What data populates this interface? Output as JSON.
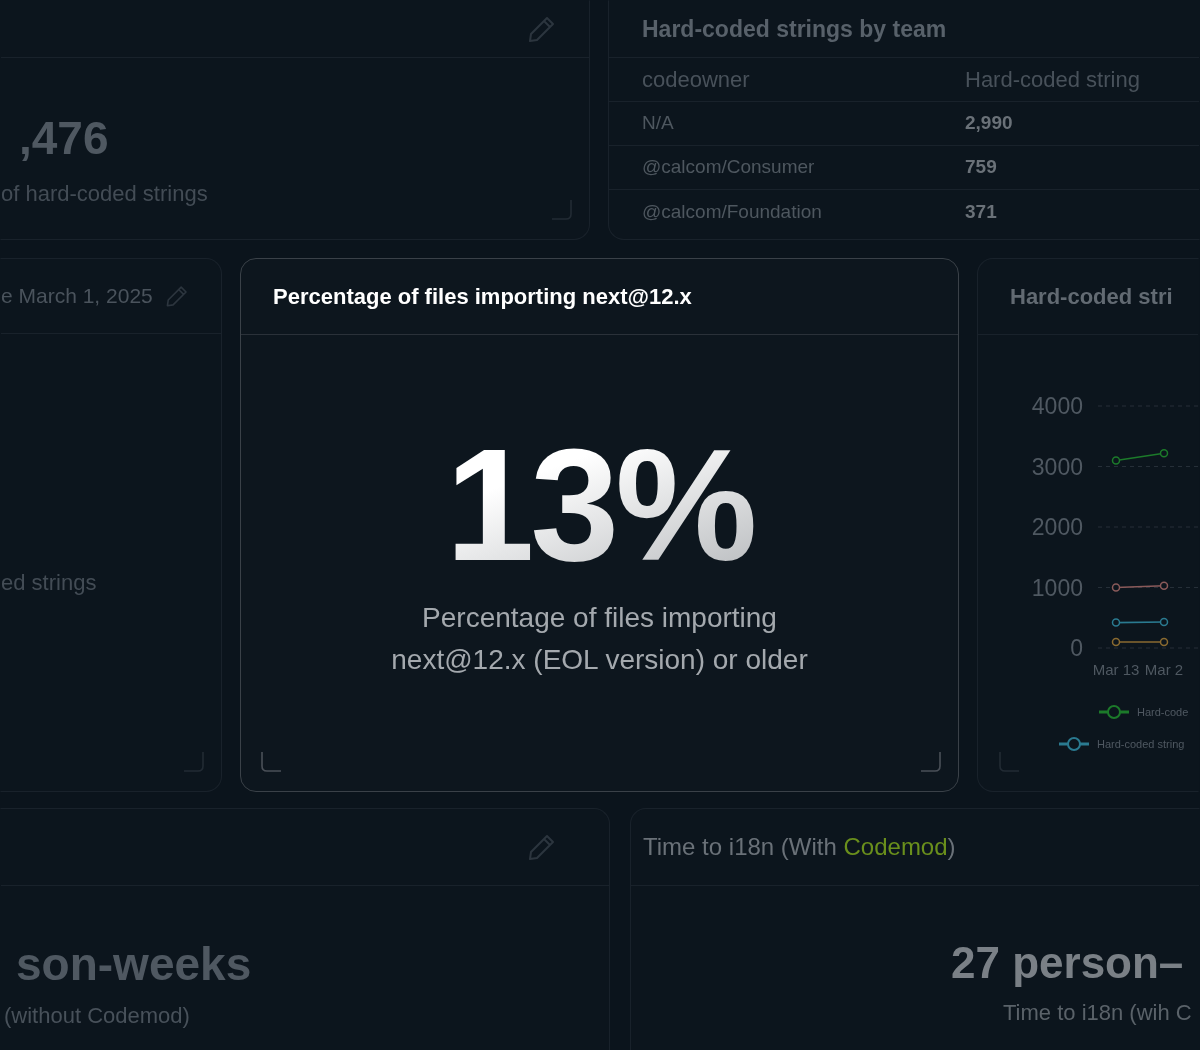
{
  "background_cards": [
    {
      "kind": "stat",
      "value": ",476",
      "caption": "of hard-coded strings"
    },
    {
      "kind": "table",
      "title": "Hard-coded strings by team",
      "columns": [
        "codeowner",
        "Hard-coded string"
      ],
      "rows": [
        [
          "N/A",
          "2,990"
        ],
        [
          "@calcom/Consumer",
          "759"
        ],
        [
          "@calcom/Foundation",
          "371"
        ]
      ]
    },
    {
      "kind": "stat",
      "title": "e March 1, 2025",
      "caption": "ed strings"
    },
    {
      "kind": "chart",
      "title": "Hard-coded stri",
      "chart_data": {
        "type": "line",
        "categories": [
          "Mar 13",
          "Mar 2"
        ],
        "ylim": [
          0,
          4000
        ],
        "yticks": [
          0,
          1000,
          2000,
          3000,
          4000
        ],
        "grid": true,
        "legend": true,
        "series": [
          {
            "name": "Hard-code",
            "color": "#1c7a2a",
            "marker": true,
            "values": [
              3100,
              3220
            ]
          },
          {
            "color": "#8a5a5a",
            "marker": true,
            "values": [
              1000,
              1030
            ]
          },
          {
            "name": "Hard-coded string",
            "color": "#2a7a90",
            "marker": true,
            "values": [
              420,
              430
            ]
          },
          {
            "color": "#8a6a30",
            "marker": true,
            "values": [
              100,
              100
            ]
          }
        ]
      }
    },
    {
      "kind": "stat",
      "value": "son-weeks",
      "caption": "(without Codemod)"
    },
    {
      "kind": "stat",
      "title": "Time to i18n (With ",
      "title_highlight": "Codemod",
      "title_after": ")",
      "value": "27 person–",
      "caption": "Time to i18n (wih C"
    }
  ],
  "focus_card": {
    "title": "Percentage of files importing next@12.x",
    "value": "13%",
    "description": "Percentage of files importing next@12.x (EOL version) or older"
  }
}
